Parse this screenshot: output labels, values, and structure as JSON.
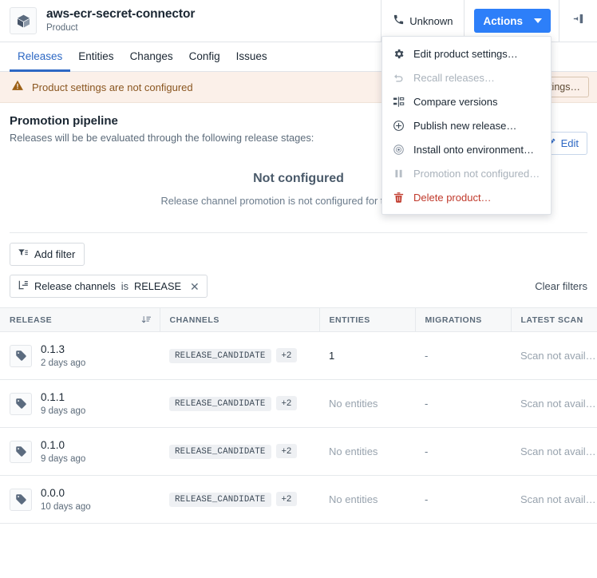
{
  "header": {
    "product_icon": "cube-icon",
    "title": "aws-ecr-secret-connector",
    "subtitle": "Product",
    "unknown_label": "Unknown",
    "unknown_icon": "phone-icon",
    "actions_label": "Actions",
    "actions_caret_icon": "chevron-down-icon",
    "panel_toggle_icon": "collapse-panel-icon",
    "accent_color": "#2d7ff9"
  },
  "tabs": [
    {
      "label": "Releases",
      "active": true
    },
    {
      "label": "Entities",
      "active": false
    },
    {
      "label": "Changes",
      "active": false
    },
    {
      "label": "Config",
      "active": false
    },
    {
      "label": "Issues",
      "active": false
    }
  ],
  "warning": {
    "icon": "warning-triangle-icon",
    "text": "Product settings are not configured",
    "action_label": "Configure settings…",
    "text_color": "#8a5620",
    "bg_color": "#fbf0e9"
  },
  "pipeline": {
    "title": "Promotion pipeline",
    "description": "Releases will be be evaluated through the following release stages:",
    "edit_label": "Edit",
    "edit_icon": "pencil-icon",
    "empty_title": "Not configured",
    "empty_description": "Release channel promotion is not configured for this product."
  },
  "filters": {
    "add_filter_label": "Add filter",
    "add_filter_icon": "filter-icon",
    "chip": {
      "icon": "branch-icon",
      "field": "Release channels",
      "operator": "is",
      "value": "RELEASE",
      "remove_icon": "close-icon"
    },
    "clear_filters_label": "Clear filters"
  },
  "table": {
    "columns": [
      {
        "label": "RELEASE",
        "sorted": true,
        "sort_icon": "sort-descending-icon"
      },
      {
        "label": "CHANNELS",
        "sorted": false
      },
      {
        "label": "ENTITIES",
        "sorted": false
      },
      {
        "label": "MIGRATIONS",
        "sorted": false
      },
      {
        "label": "LATEST SCAN",
        "sorted": false
      }
    ],
    "rows": [
      {
        "icon": "tag-icon",
        "release": "0.1.3",
        "age": "2 days ago",
        "channel": "RELEASE_CANDIDATE",
        "channel_more": "+2",
        "entities": "1",
        "entities_muted": false,
        "migrations": "-",
        "latest_scan": "Scan not avail…"
      },
      {
        "icon": "tag-icon",
        "release": "0.1.1",
        "age": "9 days ago",
        "channel": "RELEASE_CANDIDATE",
        "channel_more": "+2",
        "entities": "No entities",
        "entities_muted": true,
        "migrations": "-",
        "latest_scan": "Scan not avail…"
      },
      {
        "icon": "tag-icon",
        "release": "0.1.0",
        "age": "9 days ago",
        "channel": "RELEASE_CANDIDATE",
        "channel_more": "+2",
        "entities": "No entities",
        "entities_muted": true,
        "migrations": "-",
        "latest_scan": "Scan not avail…"
      },
      {
        "icon": "tag-icon",
        "release": "0.0.0",
        "age": "10 days ago",
        "channel": "RELEASE_CANDIDATE",
        "channel_more": "+2",
        "entities": "No entities",
        "entities_muted": true,
        "migrations": "-",
        "latest_scan": "Scan not avail…"
      }
    ]
  },
  "actions_menu": {
    "open": true,
    "items": [
      {
        "label": "Edit product settings…",
        "icon": "gear-icon",
        "state": "enabled"
      },
      {
        "label": "Recall releases…",
        "icon": "undo-icon",
        "state": "disabled"
      },
      {
        "label": "Compare versions",
        "icon": "compare-icon",
        "state": "enabled"
      },
      {
        "label": "Publish new release…",
        "icon": "plus-circle-icon",
        "state": "enabled"
      },
      {
        "label": "Install onto environment…",
        "icon": "target-icon",
        "state": "enabled"
      },
      {
        "label": "Promotion not configured…",
        "icon": "pause-icon",
        "state": "disabled"
      },
      {
        "label": "Delete product…",
        "icon": "trash-icon",
        "state": "danger"
      }
    ]
  }
}
